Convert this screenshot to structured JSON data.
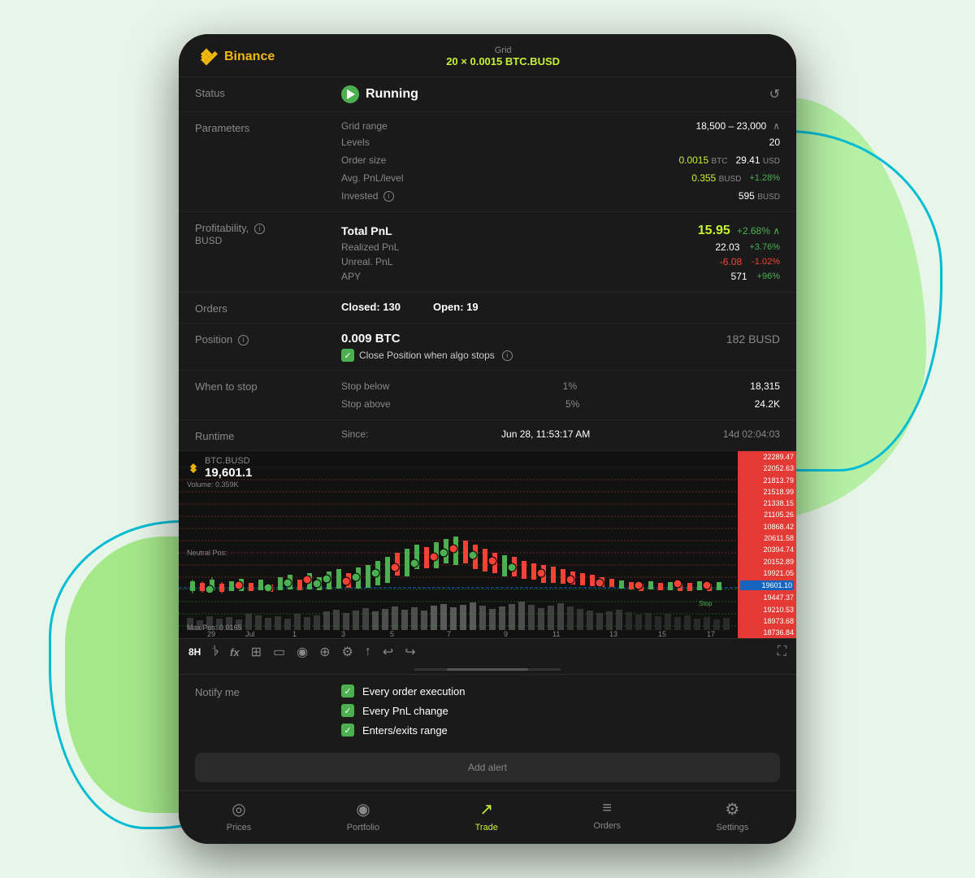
{
  "background": {
    "blob1": "green",
    "blob2": "teal-outline"
  },
  "header": {
    "logo_alt": "Binance Logo",
    "title": "Binance",
    "grid_label": "Grid",
    "grid_value": "20 × 0.0015 BTC.BUSD"
  },
  "status": {
    "label": "Status",
    "value": "Running",
    "refresh_icon": "↺"
  },
  "parameters": {
    "label": "Parameters",
    "grid_range_label": "Grid range",
    "grid_range_value": "18,500 – 23,000",
    "levels_label": "Levels",
    "levels_value": "20",
    "order_size_label": "Order size",
    "order_size_btc": "0.0015",
    "order_size_btc_unit": "BTC",
    "order_size_usd": "29.41",
    "order_size_usd_unit": "USD",
    "avg_pnl_label": "Avg. PnL/level",
    "avg_pnl_value": "0.355",
    "avg_pnl_unit": "BUSD",
    "avg_pnl_pct": "+1.28%",
    "invested_label": "Invested",
    "invested_value": "595",
    "invested_unit": "BUSD"
  },
  "profitability": {
    "label": "Profitability,",
    "unit": "BUSD",
    "total_pnl_label": "Total PnL",
    "total_pnl_value": "15.95",
    "total_pnl_pct": "+2.68%",
    "realized_label": "Realized PnL",
    "realized_value": "22.03",
    "realized_pct": "+3.76%",
    "unreal_label": "Unreal. PnL",
    "unreal_value": "-6.08",
    "unreal_pct": "-1.02%",
    "apy_label": "APY",
    "apy_value": "571",
    "apy_pct": "+96%"
  },
  "orders": {
    "label": "Orders",
    "closed_label": "Closed:",
    "closed_value": "130",
    "open_label": "Open:",
    "open_value": "19"
  },
  "position": {
    "label": "Position",
    "btc_value": "0.009 BTC",
    "busd_value": "182 BUSD",
    "close_when_stops": "Close Position when algo stops"
  },
  "when_to_stop": {
    "label": "When to stop",
    "stop_below_label": "Stop below",
    "stop_below_pct": "1%",
    "stop_below_value": "18,315",
    "stop_above_label": "Stop above",
    "stop_above_pct": "5%",
    "stop_above_value": "24.2K"
  },
  "runtime": {
    "label": "Runtime",
    "since_label": "Since:",
    "since_date": "Jun 28, 11:53:17 AM",
    "duration": "14d 02:04:03"
  },
  "chart": {
    "symbol": "BTC.BUSD",
    "price": "19,601.1",
    "timeframe": "8H",
    "price_scale": [
      "22289.47",
      "22052.63",
      "21813.79",
      "21518.99",
      "21338.15",
      "21105.26",
      "10868.42",
      "20611.58",
      "20394.74",
      "20152.89",
      "19921.05",
      "19601.10",
      "19447.37",
      "19210.53",
      "18973.68",
      "18736.84"
    ],
    "date_labels": [
      "29",
      "Jul",
      "1",
      "3",
      "5",
      "7",
      "9",
      "11",
      "13",
      "15",
      "17"
    ]
  },
  "toolbar": {
    "timeframe": "8H",
    "icons": [
      "bars-icon",
      "fx-icon",
      "crosshair-icon",
      "camera-icon",
      "eye-icon",
      "layers-icon",
      "settings-icon",
      "share-icon",
      "undo-icon",
      "redo-icon",
      "fullscreen-icon"
    ]
  },
  "notify_me": {
    "label": "Notify me",
    "items": [
      {
        "text": "Every order execution",
        "checked": true
      },
      {
        "text": "Every PnL change",
        "checked": true
      },
      {
        "text": "Enters/exits range",
        "checked": true
      }
    ]
  },
  "bottom_nav": {
    "items": [
      {
        "icon": "◎",
        "label": "Prices",
        "active": false
      },
      {
        "icon": "◉",
        "label": "Portfolio",
        "active": false
      },
      {
        "icon": "↗",
        "label": "Trade",
        "active": true
      },
      {
        "icon": "≡",
        "label": "Orders",
        "active": false
      },
      {
        "icon": "⚙",
        "label": "Settings",
        "active": false
      }
    ]
  }
}
